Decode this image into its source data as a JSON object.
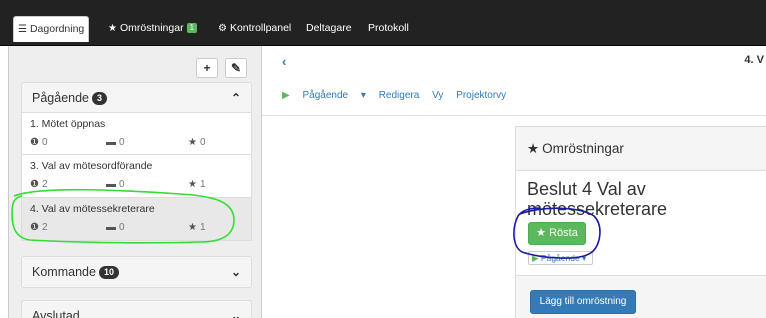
{
  "nav": {
    "tabs": [
      {
        "icon": "list-icon",
        "glyph": "☰",
        "label": "Dagordning"
      },
      {
        "icon": "star-icon",
        "glyph": "★",
        "label": "Omröstningar",
        "badge": "1"
      },
      {
        "icon": "gear-icon",
        "glyph": "⚙",
        "label": "Kontrollpanel"
      },
      {
        "label": "Deltagare"
      },
      {
        "label": "Protokoll"
      }
    ]
  },
  "sidebar": {
    "add_glyph": "+",
    "edit_glyph": "✎",
    "ongoing": {
      "label": "Pågående",
      "count": "3"
    },
    "items": [
      {
        "title": "1. Mötet öppnas",
        "alerts": "0",
        "comments": "0",
        "votes": "0"
      },
      {
        "title": "3. Val av mötesordförande",
        "alerts": "2",
        "comments": "0",
        "votes": "1"
      },
      {
        "title": "4. Val av mötessekreterare",
        "alerts": "2",
        "comments": "0",
        "votes": "1"
      }
    ],
    "upcoming": {
      "label": "Kommande",
      "count": "10"
    },
    "closed": {
      "label": "Avslutad"
    }
  },
  "main": {
    "back_glyph": "‹",
    "heading": "4. V",
    "subnav": {
      "state": "Pågående",
      "edit": "Redigera",
      "view": "Vy",
      "projector": "Projektorvy"
    },
    "polls": {
      "title": "Omröstningar",
      "resolution": "Beslut 4 Val av mötessekreterare",
      "vote_label": "Rösta",
      "status_label": "Pågående"
    },
    "add_poll_label": "Lägg till omröstning"
  },
  "colors": {
    "navbar": "#222222",
    "success": "#5cb85c",
    "primary": "#337ab7",
    "annotation_green": "#33dd33",
    "annotation_blue": "#1a1aa8"
  }
}
